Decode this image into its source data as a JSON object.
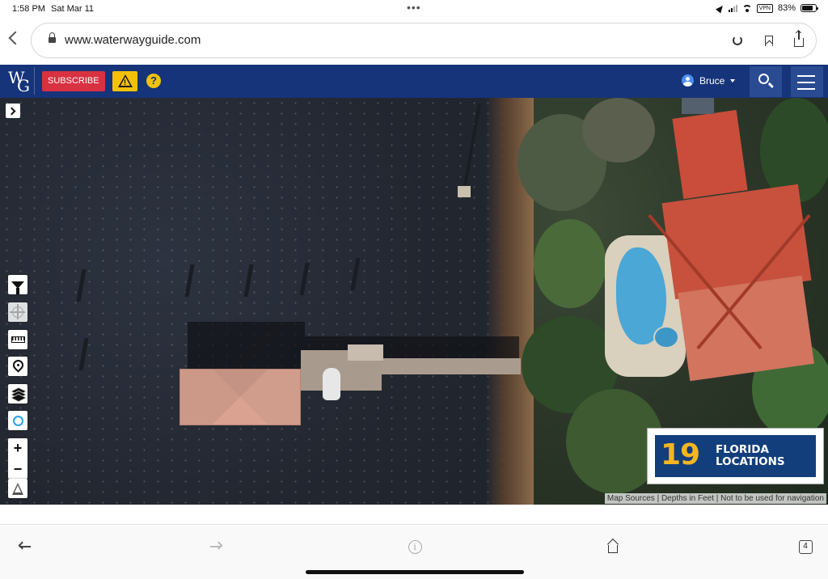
{
  "status_bar": {
    "time": "1:58 PM",
    "date": "Sat Mar 11",
    "vpn": "VPN",
    "battery": "83%",
    "battery_level": 0.83
  },
  "browser": {
    "url": "www.waterwayguide.com",
    "tab_count": "4",
    "icons": [
      "chevron-left-icon",
      "lock-icon",
      "reload-icon",
      "bookmark-icon",
      "share-icon",
      "back-arrow-icon",
      "forward-arrow-icon",
      "info-icon",
      "home-icon",
      "tabs-icon"
    ]
  },
  "site_header": {
    "logo_w": "W",
    "logo_g": "G",
    "subscribe_label": "SUBSCRIBE",
    "help_label": "?",
    "warning_label": "!",
    "user_name": "Bruce",
    "colors": {
      "header_bg": "#16347a",
      "subscribe_bg": "#d83141",
      "alert_bg": "#f4c10a"
    }
  },
  "map_controls": {
    "zoom_in": "+",
    "zoom_out": "−",
    "icons": [
      "expand-icon",
      "filter-icon",
      "locate-icon",
      "ruler-icon",
      "add-marker-icon",
      "layers-icon",
      "circle-icon",
      "zoom-in-icon",
      "zoom-out-icon",
      "north-arrow-icon"
    ]
  },
  "ad": {
    "number": "19",
    "line1": "FLORIDA",
    "line2": "LOCATIONS",
    "colors": {
      "bg": "#123f7c",
      "number": "#f3b520"
    }
  },
  "attribution": "Map Sources | Depths in Feet | Not to be used for navigation"
}
